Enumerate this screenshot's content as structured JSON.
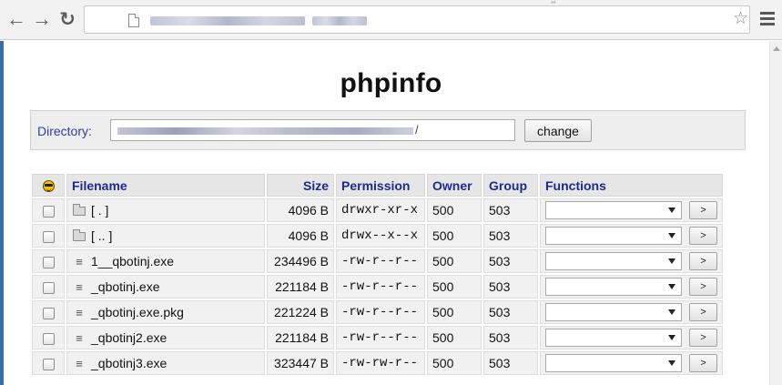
{
  "browser": {
    "tab_mark": "’’’"
  },
  "page": {
    "title": "phpinfo"
  },
  "directory": {
    "label": "Directory:",
    "path_suffix": "/",
    "change_label": "change"
  },
  "table": {
    "headers": {
      "filename": "Filename",
      "size": "Size",
      "permission": "Permission",
      "owner": "Owner",
      "group": "Group",
      "functions": "Functions"
    },
    "go_label": ">",
    "rows": [
      {
        "type": "folder",
        "name": "[ . ]",
        "size": "4096 B",
        "perm": "drwxr-xr-x",
        "owner": "500",
        "group": "503"
      },
      {
        "type": "folder",
        "name": "[ .. ]",
        "size": "4096 B",
        "perm": "drwx--x--x",
        "owner": "500",
        "group": "503"
      },
      {
        "type": "file",
        "name": "1__qbotinj.exe",
        "size": "234496 B",
        "perm": "-rw-r--r--",
        "owner": "500",
        "group": "503"
      },
      {
        "type": "file",
        "name": "_qbotinj.exe",
        "size": "221184 B",
        "perm": "-rw-r--r--",
        "owner": "500",
        "group": "503"
      },
      {
        "type": "file",
        "name": "_qbotinj.exe.pkg",
        "size": "221224 B",
        "perm": "-rw-r--r--",
        "owner": "500",
        "group": "503"
      },
      {
        "type": "file",
        "name": "_qbotinj2.exe",
        "size": "221184 B",
        "perm": "-rw-r--r--",
        "owner": "500",
        "group": "503"
      },
      {
        "type": "file",
        "name": "_qbotinj3.exe",
        "size": "323447 B",
        "perm": "-rw-rw-r--",
        "owner": "500",
        "group": "503"
      }
    ]
  }
}
